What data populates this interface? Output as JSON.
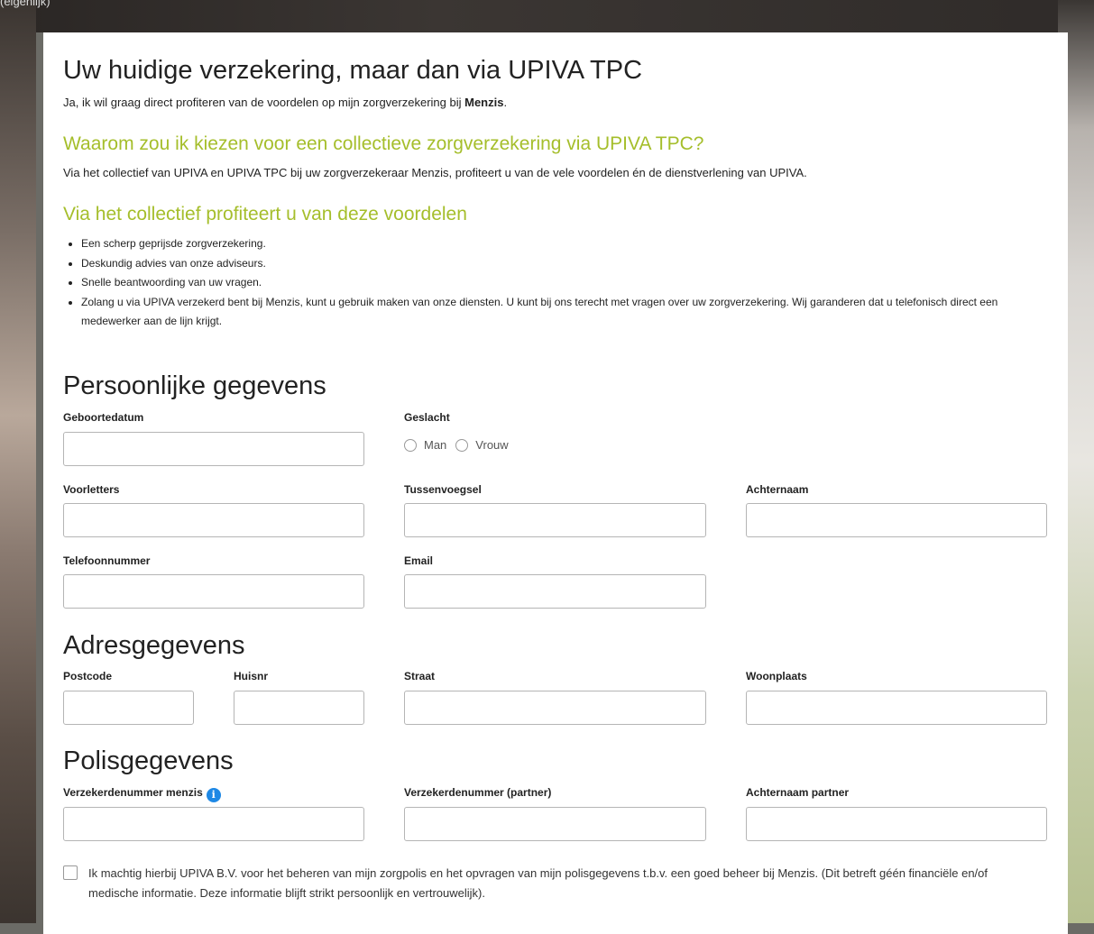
{
  "top_note": "(eigenlijk)",
  "header": {
    "title": "Uw huidige verzekering, maar dan via UPIVA TPC",
    "intro_prefix": "Ja, ik wil graag direct profiteren van de voordelen op mijn zorgverzekering bij ",
    "intro_bold": "Menzis",
    "intro_suffix": "."
  },
  "why": {
    "heading": "Waarom zou ik kiezen voor een collectieve zorgverzekering via UPIVA TPC?",
    "text": "Via het collectief van UPIVA en UPIVA TPC bij uw zorgverzekeraar Menzis, profiteert u van de vele voordelen én de dienstverlening van UPIVA."
  },
  "benefits": {
    "heading": "Via het collectief profiteert u van deze voordelen",
    "items": [
      "Een scherp geprijsde zorgverzekering.",
      "Deskundig advies van onze adviseurs.",
      "Snelle beantwoording van uw vragen.",
      "Zolang u via UPIVA verzekerd bent bij Menzis, kunt u gebruik maken van onze diensten. U kunt bij ons terecht met vragen over uw zorgverzekering. Wij garanderen dat u telefonisch direct een medewerker aan de lijn krijgt."
    ]
  },
  "personal": {
    "heading": "Persoonlijke gegevens",
    "birthdate_label": "Geboortedatum",
    "birthdate_value": "",
    "gender_label": "Geslacht",
    "gender_options": [
      "Man",
      "Vrouw"
    ],
    "initials_label": "Voorletters",
    "initials_value": "",
    "infix_label": "Tussenvoegsel",
    "infix_value": "",
    "lastname_label": "Achternaam",
    "lastname_value": "",
    "phone_label": "Telefoonnummer",
    "phone_value": "",
    "email_label": "Email",
    "email_value": ""
  },
  "address": {
    "heading": "Adresgegevens",
    "postcode_label": "Postcode",
    "postcode_value": "",
    "housenr_label": "Huisnr",
    "housenr_value": "",
    "street_label": "Straat",
    "street_value": "",
    "city_label": "Woonplaats",
    "city_value": ""
  },
  "policy": {
    "heading": "Polisgegevens",
    "insured_label": "Verzekerdenummer menzis",
    "insured_value": "",
    "info_icon": "info-icon",
    "partner_nr_label": "Verzekerdenummer (partner)",
    "partner_nr_value": "",
    "partner_lastname_label": "Achternaam partner",
    "partner_lastname_value": ""
  },
  "consent": {
    "checked": false,
    "text": "Ik machtig hierbij UPIVA B.V. voor het beheren van mijn zorgpolis en het opvragen van mijn polisgegevens t.b.v. een goed beheer bij Menzis. (Dit betreft géén financiële en/of medische informatie. Deze informatie blijft strikt persoonlijk en vertrouwelijk)."
  },
  "colors": {
    "accent_green": "#a5be2b",
    "info_blue": "#1e88e5"
  }
}
